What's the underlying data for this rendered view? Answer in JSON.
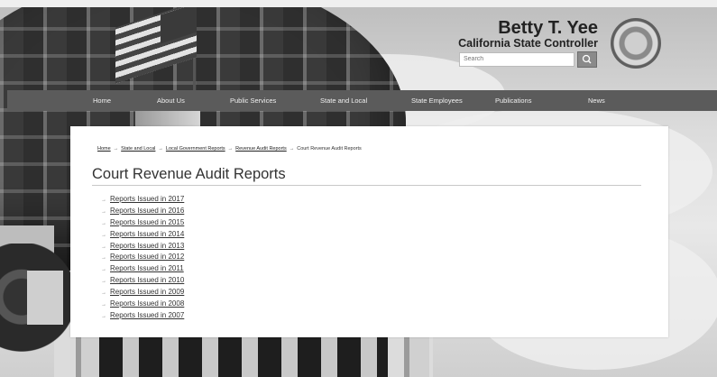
{
  "header": {
    "name": "Betty T. Yee",
    "subtitle": "California State Controller",
    "search_placeholder": "Search"
  },
  "nav": [
    {
      "label": "Home"
    },
    {
      "label": "About Us"
    },
    {
      "label": "Public Services"
    },
    {
      "label": "State and Local"
    },
    {
      "label": "State Employees"
    },
    {
      "label": "Publications"
    },
    {
      "label": "News"
    }
  ],
  "breadcrumb": {
    "items": [
      "Home",
      "State and Local",
      "Local Government Reports",
      "Revenue Audit Reports"
    ],
    "current": "Court Revenue Audit Reports",
    "separator": "→"
  },
  "page": {
    "title": "Court Revenue Audit Reports"
  },
  "reports": [
    {
      "label": "Reports Issued in 2017"
    },
    {
      "label": "Reports Issued in 2016"
    },
    {
      "label": "Reports Issued in 2015"
    },
    {
      "label": "Reports Issued in 2014"
    },
    {
      "label": "Reports Issued in 2013"
    },
    {
      "label": "Reports Issued in 2012"
    },
    {
      "label": "Reports Issued in 2011"
    },
    {
      "label": "Reports Issued in 2010"
    },
    {
      "label": "Reports Issued in 2009"
    },
    {
      "label": "Reports Issued in 2008"
    },
    {
      "label": "Reports Issued in 2007"
    }
  ],
  "list_marker": "→"
}
